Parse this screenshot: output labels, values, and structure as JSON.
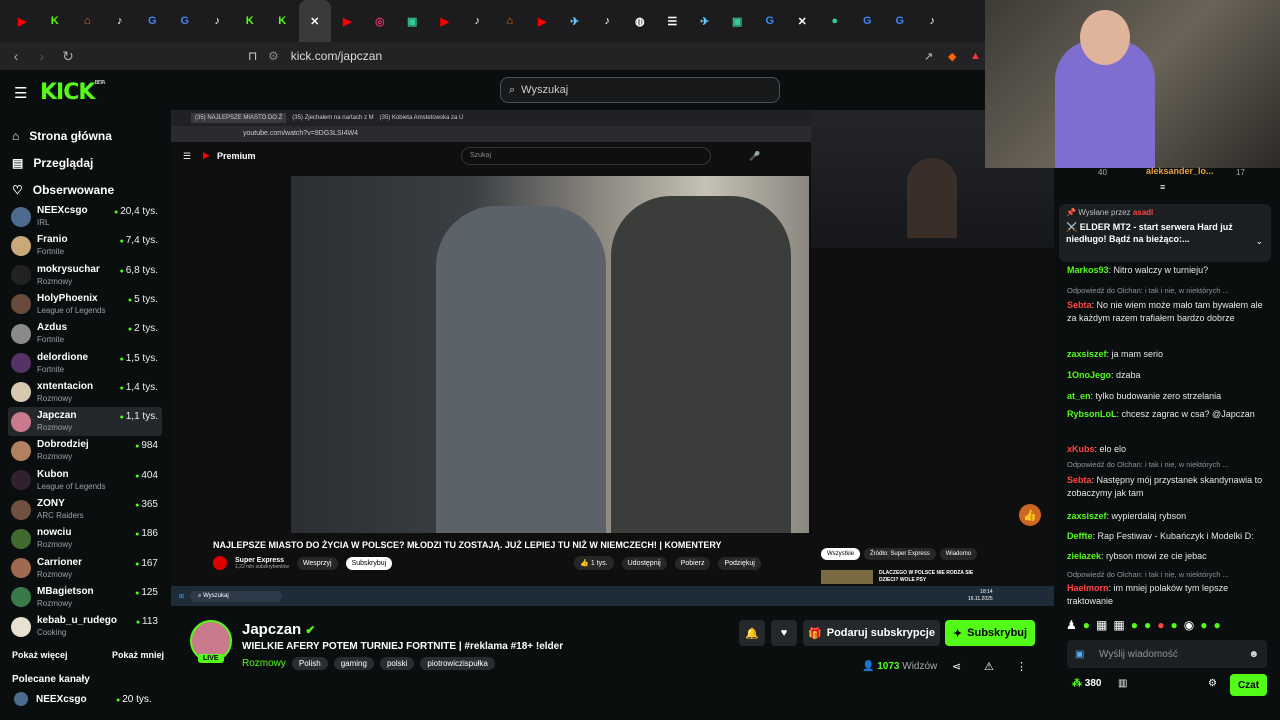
{
  "browser": {
    "url": "kick.com/japczan"
  },
  "site": {
    "logo": "KICK",
    "logo_sup": "BETA",
    "search_placeholder": "Wyszukaj"
  },
  "nav": {
    "home": "Strona główna",
    "browse": "Przeglądaj",
    "following": "Obserwowane"
  },
  "channels": [
    {
      "name": "NEEXcsgo",
      "game": "IRL",
      "viewers": "20,4 tys.",
      "color": "#4d6b8c"
    },
    {
      "name": "Franio",
      "game": "Fortnite",
      "viewers": "7,4 tys.",
      "color": "#c9a87a"
    },
    {
      "name": "mokrysuchar",
      "game": "Rozmowy",
      "viewers": "6,8 tys.",
      "color": "#222"
    },
    {
      "name": "HolyPhoenix",
      "game": "League of Legends",
      "viewers": "5 tys.",
      "color": "#6a4a3a"
    },
    {
      "name": "Azdus",
      "game": "Fortnite",
      "viewers": "2 tys.",
      "color": "#8a8a8a"
    },
    {
      "name": "delordione",
      "game": "Fortnite",
      "viewers": "1,5 tys.",
      "color": "#553366"
    },
    {
      "name": "xntentacion",
      "game": "Rozmowy",
      "viewers": "1,4 tys.",
      "color": "#d8c8b0"
    },
    {
      "name": "Japczan",
      "game": "Rozmowy",
      "viewers": "1,1 tys.",
      "color": "#c97a8c"
    },
    {
      "name": "Dobrodziej",
      "game": "Rozmowy",
      "viewers": "984",
      "color": "#b08060"
    },
    {
      "name": "Kubon",
      "game": "League of Legends",
      "viewers": "404",
      "color": "#302030"
    },
    {
      "name": "ZONY",
      "game": "ARC Raiders",
      "viewers": "365",
      "color": "#705040"
    },
    {
      "name": "nowciu",
      "game": "Rozmowy",
      "viewers": "186",
      "color": "#406a30"
    },
    {
      "name": "Carrioner",
      "game": "Rozmowy",
      "viewers": "167",
      "color": "#a06a50"
    },
    {
      "name": "MBagietson",
      "game": "Rozmowy",
      "viewers": "125",
      "color": "#3a7a4a"
    },
    {
      "name": "kebab_u_rudego",
      "game": "Cooking",
      "viewers": "113",
      "color": "#e8e0d0"
    }
  ],
  "show_more": "Pokaż więcej",
  "show_less": "Pokaż mniej",
  "recommended": {
    "heading": "Polecane kanały",
    "first_name": "NEEXcsgo",
    "first_viewers": "20 tys."
  },
  "youtube": {
    "tabs": [
      "(35) NAJLEPSZE MIASTO DO Ż",
      "(35) Zjechałem na nartach z M",
      "(35) Kobieta Amstetowska za U"
    ],
    "url": "youtube.com/watch?v=9DG3LSI4W4",
    "search": "Szukaj",
    "brand": "Premium",
    "title": "NAJLEPSZE MIASTO DO ŻYCIA W POLSCE? MŁODZI TU ZOSTAJĄ. JUŻ LEPIEJ TU NIŻ W NIEMCZECH! | KOMENTERY",
    "channel": "Super Express",
    "subs": "1,22 mln subskrybentów",
    "support": "Wesprzyj",
    "subscribe": "Subskrybuj",
    "likes": "1 tys.",
    "share": "Udostępnij",
    "download": "Pobierz",
    "thanks": "Podziękuj",
    "chip_all": "Wszystkie",
    "chip_source": "Źródło: Super Express",
    "chip_recent": "Wiadomo",
    "side_title": "DLACZEGO W POLSCE NIE RODZA SIE DZIECI? WOLE PSY",
    "taskbar_search": "Wyszukaj",
    "clock_time": "18:14",
    "clock_date": "16.11.2025"
  },
  "stream": {
    "name": "Japczan",
    "title": "WIELKIE AFERY POTEM TURNIEJ FORTNITE | #reklama #18+ !elder",
    "category": "Rozmowy",
    "tags": [
      "Polish",
      "gaming",
      "polski",
      "piotrowiczispułka"
    ],
    "live": "LIVE",
    "viewers": "1073",
    "viewers_label": "Widzów",
    "gift": "Podaruj subskrypcje",
    "subscribe": "Subskrybuj"
  },
  "chat": {
    "top_user": "aleksander_lo...",
    "top_count": "40",
    "top_count2": "17",
    "pinned_by": "Wysłane przez",
    "pinned_user": "asadi",
    "pinned_text": "⚔️ ELDER MT2 - start serwera Hard już niedługo! Bądź na bieżąco:...",
    "messages": [
      {
        "user": "Markos93",
        "color": "#53fc18",
        "text": "Nitro walczy w turnieju?"
      },
      {
        "reply": "Odpowiedź do Olchan: i tak i nie, w niektórych ..."
      },
      {
        "user": "Sebta",
        "color": "#ff4444",
        "text": "No nie wiem może mało tam bywałem ale za każdym razem trafiałem bardzo dobrze"
      },
      {
        "user": "zaxsiszef",
        "color": "#53fc18",
        "text": "ja mam serio"
      },
      {
        "user": "1OnoJego",
        "color": "#53fc18",
        "text": "dzaba"
      },
      {
        "user": "at_en",
        "color": "#53fc18",
        "text": "tylko budowanie zero strzelania"
      },
      {
        "user": "RybsonLoL",
        "color": "#53fc18",
        "text": "chcesz zagrac w csa? @Japczan"
      },
      {
        "user": "xKubs",
        "color": "#ff4444",
        "text": "elo elo"
      },
      {
        "reply": "Odpowiedź do Olchan: i tak i nie, w niektórych ..."
      },
      {
        "user": "Sebta",
        "color": "#ff4444",
        "text": "Następny mój przystanek skandynawia to zobaczymy jak tam"
      },
      {
        "user": "zaxsiszef",
        "color": "#53fc18",
        "text": "wypierdalaj rybson"
      },
      {
        "user": "Deffte",
        "color": "#53fc18",
        "text": "Rap Festiwav - Kubańczyk i Modelki D:"
      },
      {
        "user": "zielazek",
        "color": "#53fc18",
        "text": "rybson mowi ze cie jebac"
      },
      {
        "reply": "Odpowiedź do Olchan: i tak i nie, w niektórych ..."
      },
      {
        "user": "Haelmorn",
        "color": "#ff4444",
        "text": "im mniej polaków tym lepsze traktowanie"
      }
    ],
    "input_placeholder": "Wyślij wiadomość",
    "points": "380",
    "send": "Czat"
  }
}
